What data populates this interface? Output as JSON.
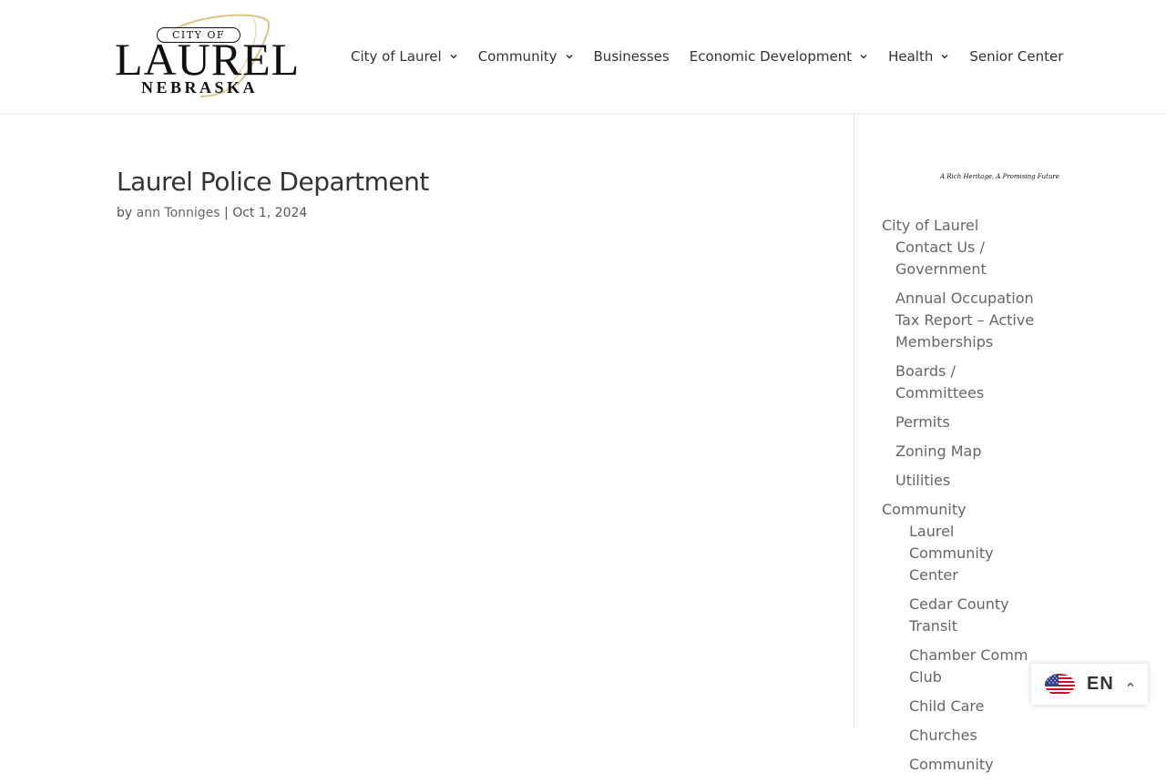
{
  "logo": {
    "city_of": "CITY OF",
    "name": "LAUREL",
    "state": "NEBRASKA"
  },
  "nav": {
    "items": [
      {
        "label": "City of Laurel",
        "has_dropdown": true
      },
      {
        "label": "Community",
        "has_dropdown": true
      },
      {
        "label": "Businesses",
        "has_dropdown": false
      },
      {
        "label": "Economic Development",
        "has_dropdown": true
      },
      {
        "label": "Health",
        "has_dropdown": true
      },
      {
        "label": "Senior Center",
        "has_dropdown": false
      }
    ]
  },
  "post": {
    "title": "Laurel Police Department",
    "by": "by",
    "author": "ann Tonniges",
    "separator": "|",
    "date": "Oct 1, 2024"
  },
  "sidebar": {
    "tagline": "A Rich Heritage, A Promising Future",
    "menu": [
      {
        "label": "City of Laurel",
        "children": [
          "Contact Us / Government",
          "Annual Occupation Tax Report – Active Memberships",
          "Boards / Committees",
          "Permits",
          "Zoning Map",
          "Utilities"
        ]
      },
      {
        "label": "Community",
        "children": [
          "Laurel Community Center",
          "Cedar County Transit",
          "Chamber Comm Club",
          "Child Care",
          "Churches",
          "Community"
        ]
      }
    ]
  },
  "language": {
    "code": "EN",
    "icons": {
      "flag": "us-flag-icon",
      "toggle": "chevron-up-icon"
    }
  },
  "colors": {
    "nav_text": "#333333",
    "body_text": "#666666",
    "title_text": "#333333",
    "logo_accent": "#d9c48a"
  }
}
